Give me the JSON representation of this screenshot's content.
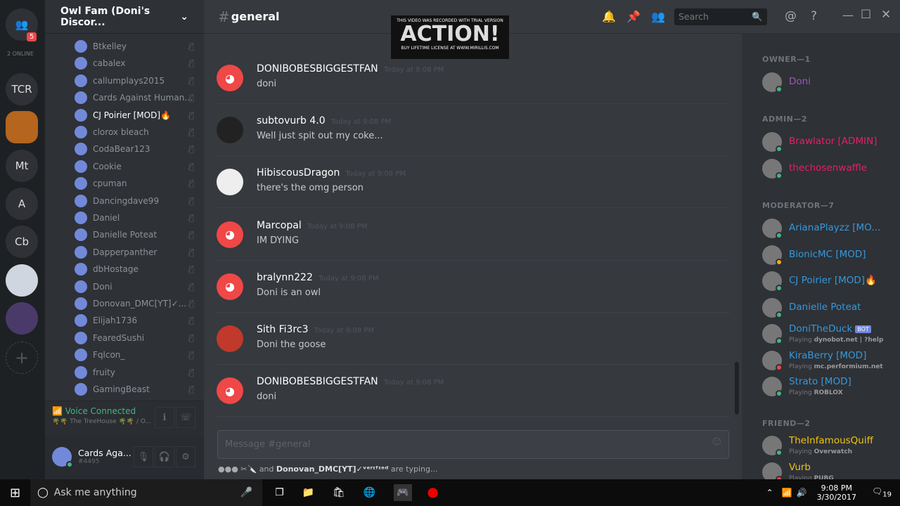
{
  "servers": {
    "online_label": "2 ONLINE",
    "badge": "5",
    "items": [
      "TCR",
      "Mt",
      "A",
      "Cb"
    ]
  },
  "channel_sidebar": {
    "server_name": "Owl Fam (Doni's Discor...",
    "voice_users": [
      "Btkelley",
      "cabalex",
      "callumplays2015",
      "Cards Against Human...",
      "CJ Poirier [MOD]🔥",
      "clorox bleach",
      "CodaBear123",
      "Cookie",
      "cpuman",
      "Dancingdave99",
      "Daniel",
      "Danielle Poteat",
      "Dapperpanther",
      "dbHostage",
      "Doni",
      "Donovan_DMC[YT]✓...",
      "Elijah1736",
      "FearedSushi",
      "Fqlcon_",
      "fruity",
      "GamingBeast"
    ],
    "voice_status": "Voice Connected",
    "voice_channel": "🌴🌴 The TreeHouse 🌴🌴 / O...",
    "user": {
      "name": "Cards Aga...",
      "tag": "#4495"
    }
  },
  "chat": {
    "channel": "general",
    "hash": "#",
    "messages": [
      {
        "author": "DONIBOBESBIGGESTFAN",
        "time": "Today at 9:08 PM",
        "text": "doni"
      },
      {
        "author": "subtovurb 4.0",
        "time": "Today at 9:08 PM",
        "text": "Well just spit out my coke..."
      },
      {
        "author": "HibiscousDragon",
        "time": "Today at 9:08 PM",
        "text": "there's the omg person"
      },
      {
        "author": "Marcopal",
        "time": "Today at 9:08 PM",
        "text": "IM DYING"
      },
      {
        "author": "bralynn222",
        "time": "Today at 9:08 PM",
        "text": "Doni is an owl"
      },
      {
        "author": "Sith Fi3rc3",
        "time": "Today at 9:08 PM",
        "text": "Doni the goose"
      },
      {
        "author": "DONIBOBESBIGGESTFAN",
        "time": "Today at 9:08 PM",
        "text": "doni"
      }
    ],
    "input_placeholder": "Message #general",
    "typing": {
      "prefix": "✂🔪 and",
      "user": "Donovan_DMC[YT]✓ᵛᵉʳᶦᶠᶦᵉᵈ",
      "suffix": "are typing..."
    },
    "search_placeholder": "Search"
  },
  "watermark": {
    "top": "THIS VIDEO WAS RECORDED WITH TRIAL VERSION",
    "logo": "ACTION!",
    "bottom": "BUY LIFETIME LICENSE AT WWW.MIRILLIS.COM"
  },
  "members": {
    "sections": [
      {
        "title": "OWNER—1",
        "members": [
          {
            "name": "Doni",
            "color": "#9b59b6",
            "status": "#43b581"
          }
        ]
      },
      {
        "title": "ADMIN—2",
        "members": [
          {
            "name": "Brawlator [ADMIN]",
            "color": "#e91e63",
            "status": "#43b581"
          },
          {
            "name": "thechosenwaffle",
            "color": "#e91e63",
            "status": "#43b581"
          }
        ]
      },
      {
        "title": "MODERATOR—7",
        "members": [
          {
            "name": "ArianaPlayzz [MO...",
            "color": "#3498db",
            "status": "#43b581"
          },
          {
            "name": "BionicMC [MOD]",
            "color": "#3498db",
            "status": "#faa61a"
          },
          {
            "name": "CJ Poirier [MOD]🔥",
            "color": "#3498db",
            "status": "#43b581"
          },
          {
            "name": "Danielle Poteat",
            "color": "#3498db",
            "status": "#43b581"
          },
          {
            "name": "DoniTheDuck",
            "color": "#3498db",
            "status": "#43b581",
            "bot": "BOT",
            "playing": "dynobot.net | ?help"
          },
          {
            "name": "KiraBerry [MOD]",
            "color": "#3498db",
            "status": "#f04747",
            "playing": "mc.performium.net"
          },
          {
            "name": "Strato [MOD]",
            "color": "#3498db",
            "status": "#43b581",
            "playing": "ROBLOX"
          }
        ]
      },
      {
        "title": "FRIEND—2",
        "members": [
          {
            "name": "TheInfamousQuiff",
            "color": "#f1c40f",
            "status": "#43b581",
            "playing": "Overwatch"
          },
          {
            "name": "Vurb",
            "color": "#f1c40f",
            "status": "#f04747",
            "playing": "PUBG"
          }
        ]
      }
    ],
    "playing_label": "Playing"
  },
  "taskbar": {
    "search": "Ask me anything",
    "time": "9:08 PM",
    "date": "3/30/2017",
    "notifications": "19"
  }
}
